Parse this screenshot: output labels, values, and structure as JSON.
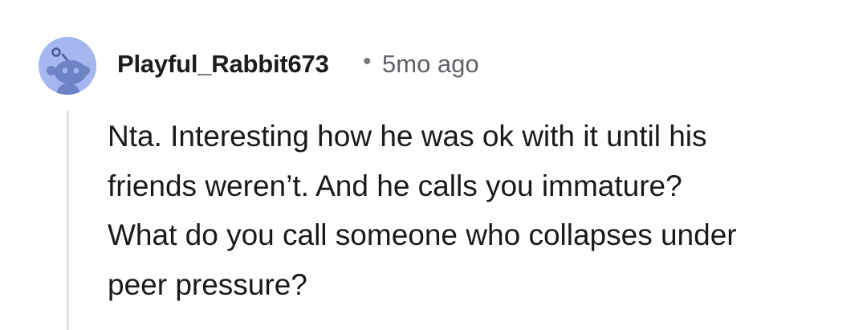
{
  "comment": {
    "author": "Playful_Rabbit673",
    "separator": "•",
    "timestamp": "5mo ago",
    "avatar_icon": "snoo-avatar-icon",
    "avatar_color": "#a5b7f0",
    "body_lines": [
      "Nta. Interesting how he was ok with it until his",
      "friends weren’t. And he calls you immature?",
      "What do you call someone who collapses under",
      "peer pressure?"
    ]
  }
}
